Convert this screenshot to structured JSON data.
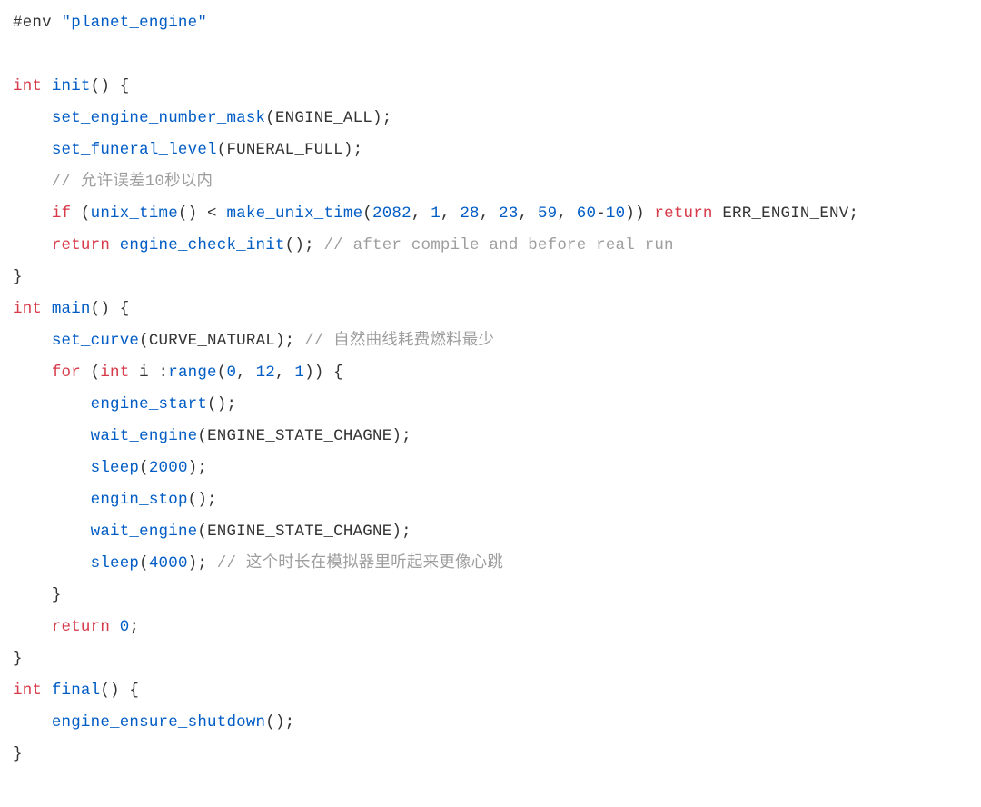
{
  "pp_env": "#env",
  "str_planet": "\"planet_engine\"",
  "kw_int": "int",
  "kw_if": "if",
  "kw_return": "return",
  "kw_for": "for",
  "fn_init": "init",
  "fn_main": "main",
  "fn_final": "final",
  "fn_set_engine_number_mask": "set_engine_number_mask",
  "fn_set_funeral_level": "set_funeral_level",
  "fn_unix_time": "unix_time",
  "fn_make_unix_time": "make_unix_time",
  "fn_engine_check_init": "engine_check_init",
  "fn_set_curve": "set_curve",
  "fn_range": "range",
  "fn_engine_start": "engine_start",
  "fn_wait_engine": "wait_engine",
  "fn_sleep": "sleep",
  "fn_engin_stop": "engin_stop",
  "fn_engine_ensure_shutdown": "engine_ensure_shutdown",
  "id_ENGINE_ALL": "ENGINE_ALL",
  "id_FUNERAL_FULL": "FUNERAL_FULL",
  "id_ERR_ENGIN_ENV": "ERR_ENGIN_ENV",
  "id_CURVE_NATURAL": "CURVE_NATURAL",
  "id_ENGINE_STATE_CHAGNE": "ENGINE_STATE_CHAGNE",
  "id_i": "i",
  "n_2082": "2082",
  "n_1": "1",
  "n_28": "28",
  "n_23": "23",
  "n_59": "59",
  "n_60": "60",
  "n_10": "10",
  "n_0": "0",
  "n_12": "12",
  "n_2000": "2000",
  "n_4000": "4000",
  "cm_allow10s": "// 允许误差10秒以内",
  "cm_after_compile": "// after compile and before real run",
  "cm_natural_curve": "// 自然曲线耗费燃料最少",
  "cm_heartbeat": "// 这个时长在模拟器里听起来更像心跳",
  "p_ocp": "() {",
  "p_op": "(",
  "p_cp": ")",
  "p_ocb": "{",
  "p_ccb": "}",
  "p_sc": ";",
  "p_cps": ");",
  "p_cs": ", ",
  "p_lt": " < ",
  "p_minus": "-",
  "p_cpcp": ")) ",
  "p_colon": " :",
  "p_sp": " "
}
